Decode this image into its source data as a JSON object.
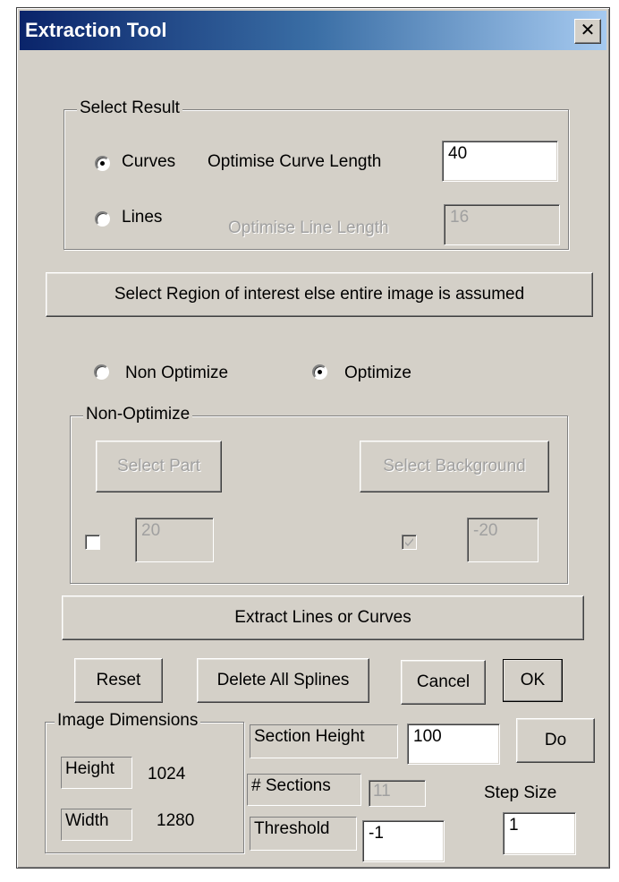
{
  "window": {
    "title": "Extraction Tool",
    "close_glyph": "✕"
  },
  "select_result": {
    "group_label": "Select Result",
    "curves_label": "Curves",
    "curves_selected": true,
    "optimise_curve_label": "Optimise Curve Length",
    "optimise_curve_value": "40",
    "lines_label": "Lines",
    "lines_selected": false,
    "optimise_line_label": "Optimise Line Length",
    "optimise_line_value": "16"
  },
  "region_button_label": "Select Region of interest else entire image is assumed",
  "mode": {
    "non_optimize_label": "Non Optimize",
    "non_optimize_selected": false,
    "optimize_label": "Optimize",
    "optimize_selected": true
  },
  "non_optimize_group": {
    "group_label": "Non-Optimize",
    "select_part_label": "Select Part",
    "select_background_label": "Select Background",
    "part_checked": false,
    "part_value": "20",
    "background_checked": true,
    "background_value": "-20"
  },
  "extract_button_label": "Extract Lines or Curves",
  "actions": {
    "reset_label": "Reset",
    "delete_splines_label": "Delete All Splines",
    "cancel_label": "Cancel",
    "ok_label": "OK"
  },
  "image_dimensions": {
    "group_label": "Image Dimensions",
    "height_label": "Height",
    "height_value": "1024",
    "width_label": "Width",
    "width_value": "1280"
  },
  "sections": {
    "section_height_label": "Section Height",
    "section_height_value": "100",
    "do_label": "Do",
    "num_sections_label": "# Sections",
    "num_sections_value": "11",
    "step_size_label": "Step Size",
    "step_size_value": "1",
    "threshold_label": "Threshold",
    "threshold_value": "-1"
  },
  "colors": {
    "face": "#d4d0c8",
    "title_start": "#0a246a",
    "title_end": "#a6caf0",
    "disabled_text": "#a0a0a0"
  }
}
